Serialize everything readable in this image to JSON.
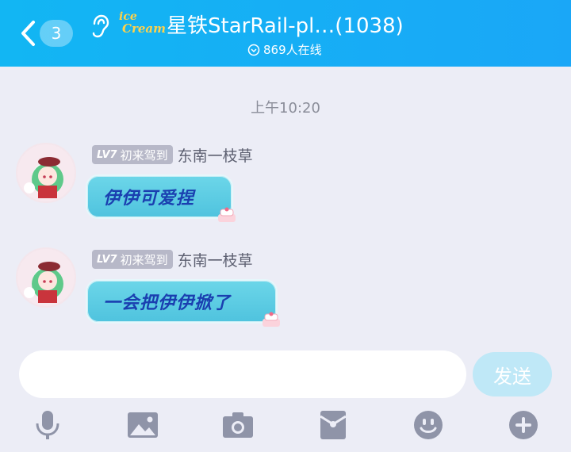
{
  "header": {
    "back_badge": "3",
    "logo_line1": "ice",
    "logo_line2": "Cream",
    "title": "星铁StarRail-pl…(1038)",
    "online": "869人在线"
  },
  "chat": {
    "timestamp": "上午10:20",
    "messages": [
      {
        "level": "LV7",
        "title": "初来驾到",
        "nickname": "东南一枝草",
        "text": "伊伊可爱捏"
      },
      {
        "level": "LV7",
        "title": "初来驾到",
        "nickname": "东南一枝草",
        "text": "一会把伊伊掀了"
      }
    ]
  },
  "input": {
    "placeholder": "",
    "send_label": "发送"
  },
  "toolbar": [
    "microphone-icon",
    "image-icon",
    "camera-icon",
    "red-packet-icon",
    "emoji-icon",
    "plus-icon"
  ],
  "colors": {
    "header": "#15b0f5",
    "bubble": "#5ccbe3",
    "bubble_text": "#1a3fb0",
    "send_disabled": "#bfe8f7",
    "icon": "#8f94a8"
  }
}
